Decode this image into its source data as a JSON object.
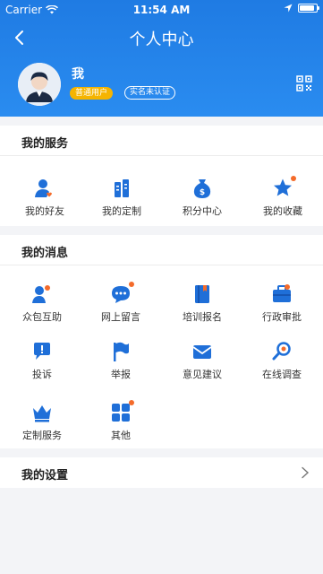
{
  "status_bar": {
    "carrier": "Carrier",
    "time": "11:54 AM",
    "battery_level": 0.9
  },
  "nav": {
    "title": "个人中心"
  },
  "profile": {
    "name": "我",
    "member_badge": "普通用户",
    "verify_badge": "实名未认证"
  },
  "services": {
    "title": "我的服务",
    "items": [
      {
        "label": "我的好友",
        "icon": "friends-icon"
      },
      {
        "label": "我的定制",
        "icon": "custom-icon"
      },
      {
        "label": "积分中心",
        "icon": "points-icon"
      },
      {
        "label": "我的收藏",
        "icon": "favorites-icon"
      }
    ]
  },
  "messages": {
    "title": "我的消息",
    "items": [
      {
        "label": "众包互助",
        "icon": "crowdsource-icon"
      },
      {
        "label": "网上留言",
        "icon": "message-icon"
      },
      {
        "label": "培训报名",
        "icon": "training-icon"
      },
      {
        "label": "行政审批",
        "icon": "approval-icon"
      },
      {
        "label": "投诉",
        "icon": "complaint-icon"
      },
      {
        "label": "举报",
        "icon": "report-flag-icon"
      },
      {
        "label": "意见建议",
        "icon": "suggestion-icon"
      },
      {
        "label": "在线调查",
        "icon": "survey-icon"
      },
      {
        "label": "定制服务",
        "icon": "crown-icon"
      },
      {
        "label": "其他",
        "icon": "other-grid-icon"
      }
    ]
  },
  "settings": {
    "title": "我的设置"
  },
  "colors": {
    "header_blue": "#2485ea",
    "icon_blue": "#1f6fd8",
    "badge_yellow": "#f5b400",
    "dot_orange": "#f46b2a"
  }
}
